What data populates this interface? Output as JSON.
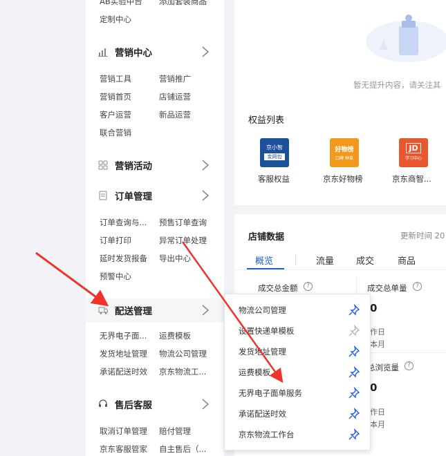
{
  "sidebar": {
    "top_items": [
      "AB实验中台",
      "添加套装商品",
      "定制中心"
    ],
    "sections": [
      {
        "title": "营销中心",
        "icon": "bar-chart-icon",
        "items": [
          "营销工具",
          "营销推广",
          "营销首页",
          "店铺运营",
          "客户运营",
          "新品运营",
          "联合营销"
        ]
      },
      {
        "title": "营销活动",
        "icon": "grid-icon",
        "items": []
      },
      {
        "title": "订单管理",
        "icon": "document-icon",
        "items": [
          "订单查询与...",
          "预售订单查询",
          "订单打印",
          "异常订单处理",
          "延时发货报备",
          "导出中心",
          "预警中心"
        ]
      },
      {
        "title": "配送管理",
        "icon": "truck-icon",
        "items": [
          "无界电子面...",
          "运费模板",
          "发货地址管理",
          "物流公司管理",
          "承诺配送时效",
          "京东物流工..."
        ]
      },
      {
        "title": "售后客服",
        "icon": "headset-icon",
        "items": [
          "取消订单管理",
          "赔付管理",
          "京东客服管家",
          "自主售后（..."
        ]
      }
    ]
  },
  "card1": {
    "empty_text": "暂无提升内容，请关注其",
    "benefits_title": "权益列表",
    "benefits": [
      {
        "label": "客服权益",
        "icon_line1": "京小智",
        "icon_line2": "变网包",
        "color": "#1c4f9c"
      },
      {
        "label": "京东好物榜",
        "icon_line1": "好物榜",
        "icon_line2": "口碑 种草",
        "color": "#f39a1e"
      },
      {
        "label": "京东商智...",
        "icon_line1": "JD",
        "icon_line2": "学习中心",
        "color": "#e8572e"
      }
    ]
  },
  "card2": {
    "title": "店铺数据",
    "update_time": "更新时间 20",
    "tabs": [
      "概览",
      "流量",
      "成交",
      "商品"
    ],
    "active_tab": "概览",
    "metric1_label": "成交总金额",
    "metric2_label": "成交总单量",
    "metric2_value": "0",
    "metric2_sub1": "作日",
    "metric2_sub2": "本月",
    "metric3_label": "总浏览量",
    "metric3_value": "0",
    "metric3_sub1": "作日",
    "metric3_sub2": "本月"
  },
  "popup": {
    "items": [
      "物流公司管理",
      "设置快递单模板",
      "发货地址管理",
      "运费模板",
      "无界电子面单服务",
      "承诺配送时效",
      "京东物流工作台"
    ]
  },
  "colors": {
    "accent": "#1f5fd8",
    "arrow": "#f0322a"
  }
}
